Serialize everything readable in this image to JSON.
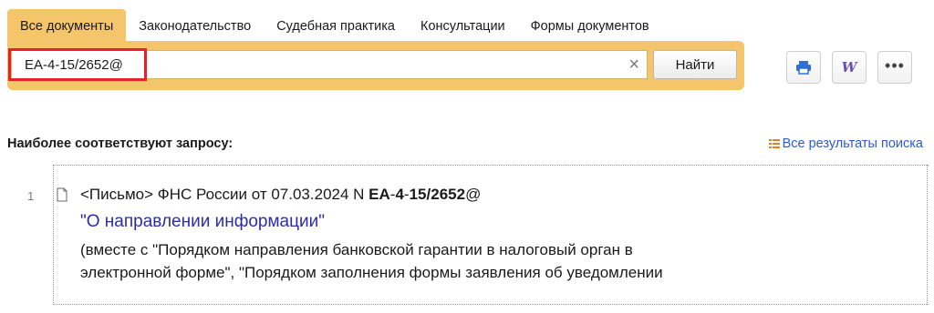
{
  "tabs": [
    {
      "label": "Все документы",
      "active": true
    },
    {
      "label": "Законодательство"
    },
    {
      "label": "Судебная практика"
    },
    {
      "label": "Консультации"
    },
    {
      "label": "Формы документов"
    }
  ],
  "search": {
    "value": "ЕА-4-15/2652@",
    "clear_icon": "×",
    "find_label": "Найти"
  },
  "toolbar": {
    "print_icon": "print-icon",
    "word_icon": "W",
    "more_icon": "•••"
  },
  "section_title": "Наиболее соответствуют запросу:",
  "all_results_label": "Все результаты поиска",
  "result": {
    "index": "1",
    "prefix": "<Письмо> ФНС России от 07.03.2024 N ",
    "number_parts": [
      "ЕА",
      "-",
      "4",
      "-",
      "15",
      "/",
      "2652",
      "@"
    ],
    "title": "\"О направлении информации\"",
    "desc_line1": "(вместе с \"Порядком направления банковской гарантии в налоговый орган в",
    "desc_line2": "электронной форме\", \"Порядком заполнения формы заявления об уведомлении"
  },
  "colors": {
    "accent": "#f5c56c",
    "link": "#2a5bd7",
    "title_link": "#2b2bb0",
    "highlight": "#e8202a"
  }
}
